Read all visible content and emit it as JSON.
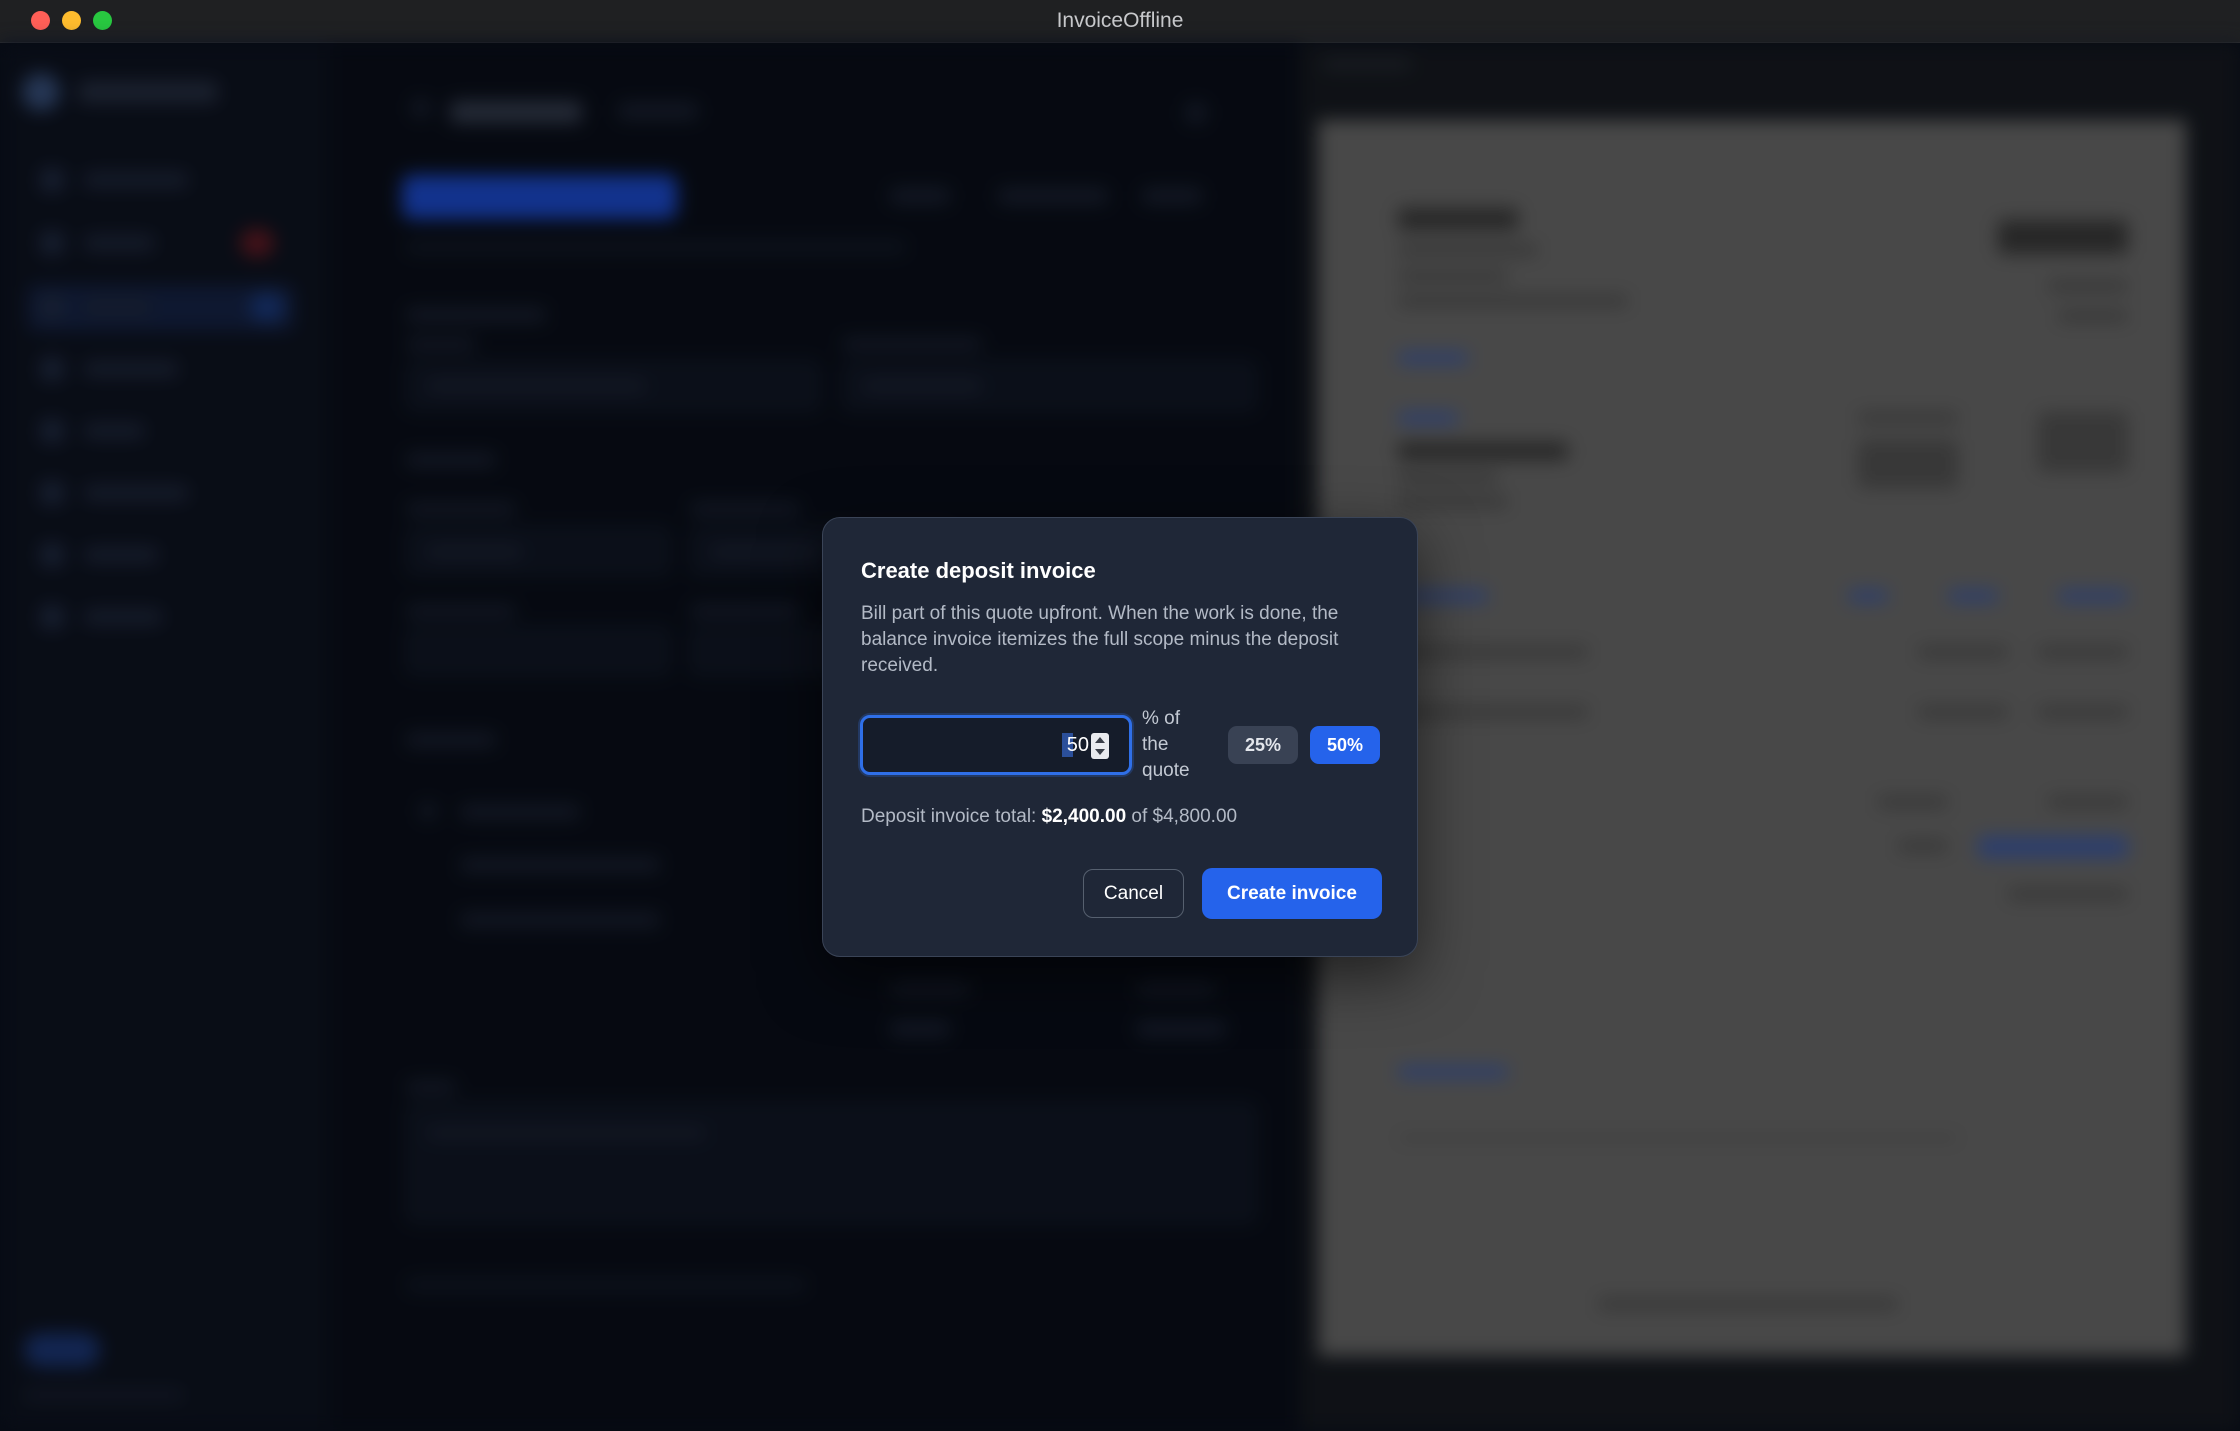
{
  "window": {
    "title": "InvoiceOffline"
  },
  "dialog": {
    "title": "Create deposit invoice",
    "description": "Bill part of this quote upfront. When the work is done, the balance invoice itemizes the full scope minus the deposit received.",
    "percent_input": {
      "value": "50",
      "suffix": "% of the quote"
    },
    "presets": [
      {
        "label": "25%",
        "selected": false
      },
      {
        "label": "50%",
        "selected": true
      }
    ],
    "total": {
      "prefix": "Deposit invoice total:",
      "amount": "$2,400.00",
      "of_text": "of $4,800.00"
    },
    "cancel_label": "Cancel",
    "create_label": "Create invoice"
  },
  "colors": {
    "accent": "#2563eb",
    "modal_bg": "#1f2737",
    "overlay_bg": "#0b1120"
  }
}
